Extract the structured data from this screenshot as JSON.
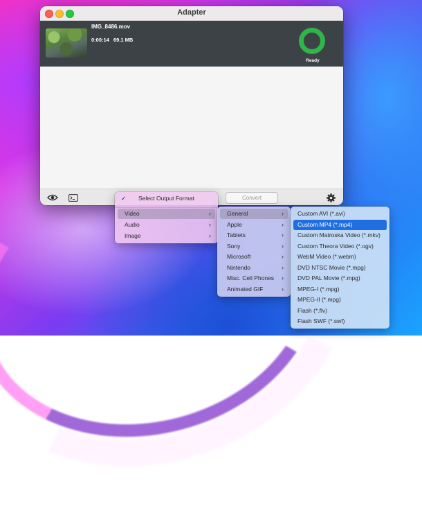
{
  "window": {
    "title": "Adapter"
  },
  "file": {
    "name": "IMG_8486.mov",
    "duration": "0:00:14",
    "size": "69.1 MB",
    "status": "Ready",
    "status_color": "#2fb54a"
  },
  "toolbar": {
    "convert_label": "Convert",
    "icons": [
      "eye-icon",
      "terminal-icon",
      "gear-icon"
    ]
  },
  "menu_level1": {
    "header": "Select Output Format",
    "items": [
      {
        "label": "Video",
        "selected": true
      },
      {
        "label": "Audio",
        "selected": false
      },
      {
        "label": "Image",
        "selected": false
      }
    ]
  },
  "menu_level2": {
    "items": [
      {
        "label": "General",
        "selected": true
      },
      {
        "label": "Apple"
      },
      {
        "label": "Tablets"
      },
      {
        "label": "Sony"
      },
      {
        "label": "Microsoft"
      },
      {
        "label": "Nintendo"
      },
      {
        "label": "Misc. Cell Phones"
      },
      {
        "label": "Animated GIF"
      }
    ]
  },
  "menu_level3": {
    "items": [
      {
        "label": "Custom AVI (*.avi)"
      },
      {
        "label": "Custom MP4 (*.mp4)",
        "highlighted": true
      },
      {
        "label": "Custom Matroska Video (*.mkv)"
      },
      {
        "label": "Custom Theora Video (*.ogv)"
      },
      {
        "label": "WebM Video (*.webm)"
      },
      {
        "label": "DVD NTSC Movie (*.mpg)"
      },
      {
        "label": "DVD PAL Movie (*.mpg)"
      },
      {
        "label": "MPEG-I (*.mpg)"
      },
      {
        "label": "MPEG-II (*.mpg)"
      },
      {
        "label": "Flash (*.flv)"
      },
      {
        "label": "Flash SWF (*.swf)"
      }
    ],
    "highlight_color": "#1f6fe0"
  }
}
